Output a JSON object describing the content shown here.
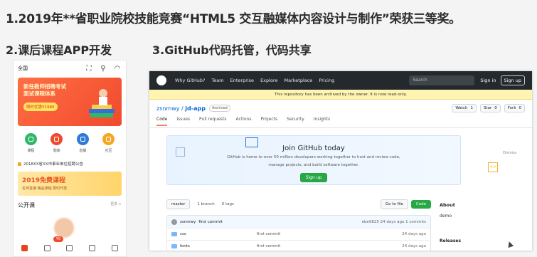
{
  "headings": {
    "h1": "1.2019年**省职业院校技能竞赛“HTML5 交互融媒体内容设计与制作”荣获三等奖。",
    "h2": "2.课后课程APP开发",
    "h3": "3.GitHub代码托管，代码共享"
  },
  "phone": {
    "location": "全国",
    "banner_title_1": "新任教师招聘考试",
    "banner_title_2": "面试课程体系",
    "banner_badge": "限时优惠¥1980",
    "icons": [
      {
        "label": "课程",
        "color": "#2fb76a"
      },
      {
        "label": "题库",
        "color": "#f04a2c"
      },
      {
        "label": "直播",
        "color": "#2f7ad9"
      },
      {
        "label": "社区",
        "color": "#f6a623"
      }
    ],
    "news": "2018XX省XX市事业单位招聘公告",
    "banner2_title": "2019免费课程",
    "banner2_sub": "名师直播 精品课程 限时开放",
    "section_title": "公开课",
    "section_more": "更多 >",
    "teacher_tag": "¥0"
  },
  "github": {
    "nav": [
      "Why GitHub?",
      "Team",
      "Enterprise",
      "Explore",
      "Marketplace",
      "Pricing"
    ],
    "search_placeholder": "Search",
    "signin": "Sign in",
    "signup": "Sign up",
    "archived_notice": "This repository has been archived by the owner. It is now read-only.",
    "owner": "zsnmwy",
    "repo": "jd-app",
    "archived_badge": "Archived",
    "watch_label": "Watch",
    "watch_count": "1",
    "star_label": "Star",
    "star_count": "0",
    "fork_label": "Fork",
    "fork_count": "0",
    "tabs": [
      "Code",
      "Issues",
      "Pull requests",
      "Actions",
      "Projects",
      "Security",
      "Insights"
    ],
    "join_title": "Join GitHub today",
    "join_text_1": "GitHub is home to over 50 million developers working together to host and review code,",
    "join_text_2": "manage projects, and build software together.",
    "join_button": "Sign up",
    "dismiss": "Dismiss",
    "branch": "master",
    "branch_count": "1 branch",
    "tag_count": "0 tags",
    "go_to_file": "Go to file",
    "code_button": "Code",
    "commit_author": "zsnmwy",
    "commit_msg": "first commit",
    "commit_hash": "ebe9825",
    "commit_time": "24 days ago",
    "commit_count": "1 commits",
    "files": [
      {
        "name": "css",
        "msg": "first commit",
        "time": "24 days ago"
      },
      {
        "name": "fonts",
        "msg": "first commit",
        "time": "24 days ago"
      }
    ],
    "about_title": "About",
    "about_desc": "demo",
    "releases": "Releases"
  }
}
